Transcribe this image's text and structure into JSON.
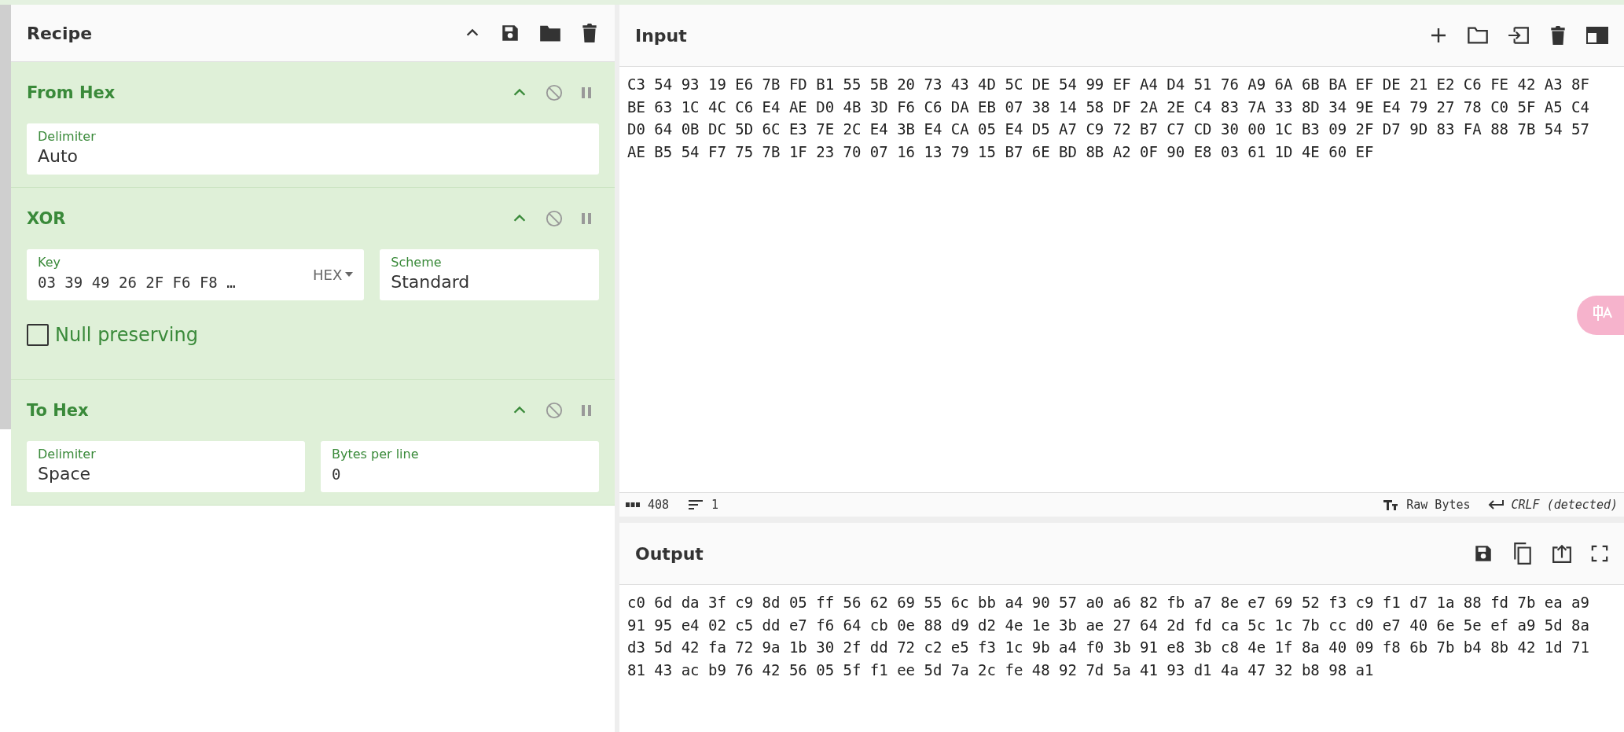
{
  "recipe": {
    "title": "Recipe",
    "operations": [
      {
        "kind": "op",
        "name": "From Hex",
        "fields": [
          {
            "kind": "text",
            "label": "Delimiter",
            "value": "Auto"
          }
        ]
      },
      {
        "kind": "op",
        "name": "XOR",
        "fields": [
          {
            "kind": "keyed",
            "label": "Key",
            "value": "03 39 49 26 2F F6 F8 …",
            "option": "HEX"
          },
          {
            "kind": "text",
            "label": "Scheme",
            "value": "Standard"
          }
        ],
        "checkboxes": [
          {
            "label": "Null preserving",
            "checked": false
          }
        ]
      },
      {
        "kind": "op",
        "name": "To Hex",
        "fields": [
          {
            "kind": "text",
            "label": "Delimiter",
            "value": "Space"
          },
          {
            "kind": "mono",
            "label": "Bytes per line",
            "value": "0"
          }
        ]
      }
    ]
  },
  "input": {
    "title": "Input",
    "lines": [
      "C3 54 93 19 E6 7B FD B1 55 5B 20 73 43 4D 5C DE 54 99 EF A4 D4 51 76 A9 6A 6B BA EF DE 21 E2 C6 FE 42 A3 8F",
      "BE 63 1C 4C C6 E4 AE D0 4B 3D F6 C6 DA EB 07 38 14 58 DF 2A 2E C4 83 7A 33 8D 34 9E E4 79 27 78 C0 5F A5 C4",
      "D0 64 0B DC 5D 6C E3 7E 2C E4 3B E4 CA 05 E4 D5 A7 C9 72 B7 C7 CD 30 00 1C B3 09 2F D7 9D 83 FA 88 7B 54 57",
      "AE B5 54 F7 75 7B 1F 23 70 07 16 13 79 15 B7 6E BD 8B A2 0F 90 E8 03 61 1D 4E 60 EF"
    ],
    "status": {
      "length": "408",
      "line_count": "1",
      "encoding": "Raw Bytes",
      "eol": "CRLF (detected)"
    }
  },
  "output": {
    "title": "Output",
    "lines": [
      "c0 6d da 3f c9 8d 05 ff 56 62 69 55 6c bb a4 90 57 a0 a6 82 fb a7 8e e7 69 52 f3 c9 f1 d7 1a 88 fd 7b ea a9",
      "91 95 e4 02 c5 dd e7 f6 64 cb 0e 88 d9 d2 4e 1e 3b ae 27 64 2d fd ca 5c 1c 7b cc d0 e7 40 6e 5e ef a9 5d 8a",
      "d3 5d 42 fa 72 9a 1b 30 2f dd 72 c2 e5 f3 1c 9b a4 f0 3b 91 e8 3b c8 4e 1f 8a 40 09 f8 6b 7b b4 8b 42 1d 71",
      "81 43 ac b9 76 42 56 05 5f f1 ee 5d 7a 2c fe 48 92 7d 5a 41 93 d1 4a 47 32 b8 98 a1"
    ]
  }
}
